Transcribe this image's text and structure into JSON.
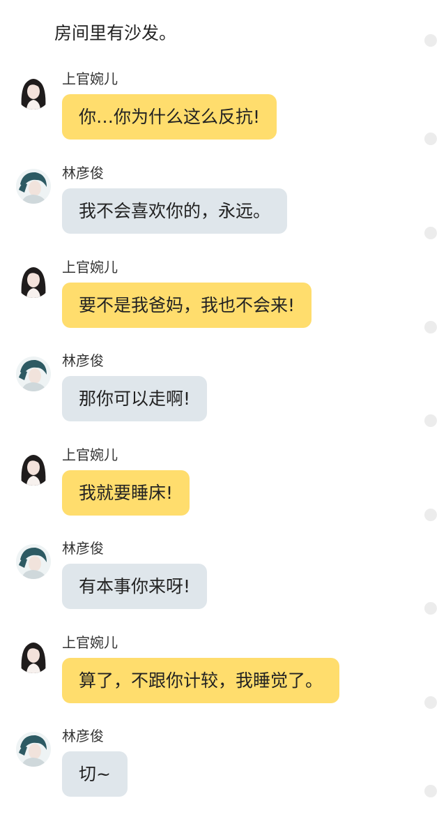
{
  "narration": "房间里有沙发。",
  "messages": [
    {
      "sender": "上官婉儿",
      "text": "你…你为什么这么反抗!",
      "style": "yellow",
      "avatar": "girl-avatar"
    },
    {
      "sender": "林彦俊",
      "text": "我不会喜欢你的，永远。",
      "style": "blue",
      "avatar": "boy-avatar"
    },
    {
      "sender": "上官婉儿",
      "text": "要不是我爸妈，我也不会来!",
      "style": "yellow",
      "avatar": "girl-avatar"
    },
    {
      "sender": "林彦俊",
      "text": "那你可以走啊!",
      "style": "blue",
      "avatar": "boy-avatar"
    },
    {
      "sender": "上官婉儿",
      "text": "我就要睡床!",
      "style": "yellow",
      "avatar": "girl-avatar"
    },
    {
      "sender": "林彦俊",
      "text": "有本事你来呀!",
      "style": "blue",
      "avatar": "boy-avatar"
    },
    {
      "sender": "上官婉儿",
      "text": "算了，不跟你计较，我睡觉了。",
      "style": "yellow",
      "avatar": "girl-avatar"
    },
    {
      "sender": "林彦俊",
      "text": "切~",
      "style": "blue",
      "avatar": "boy-avatar"
    }
  ],
  "colors": {
    "yellow_bubble": "#ffdd6d",
    "blue_bubble": "#dfe6eb",
    "dot": "#ececec"
  }
}
